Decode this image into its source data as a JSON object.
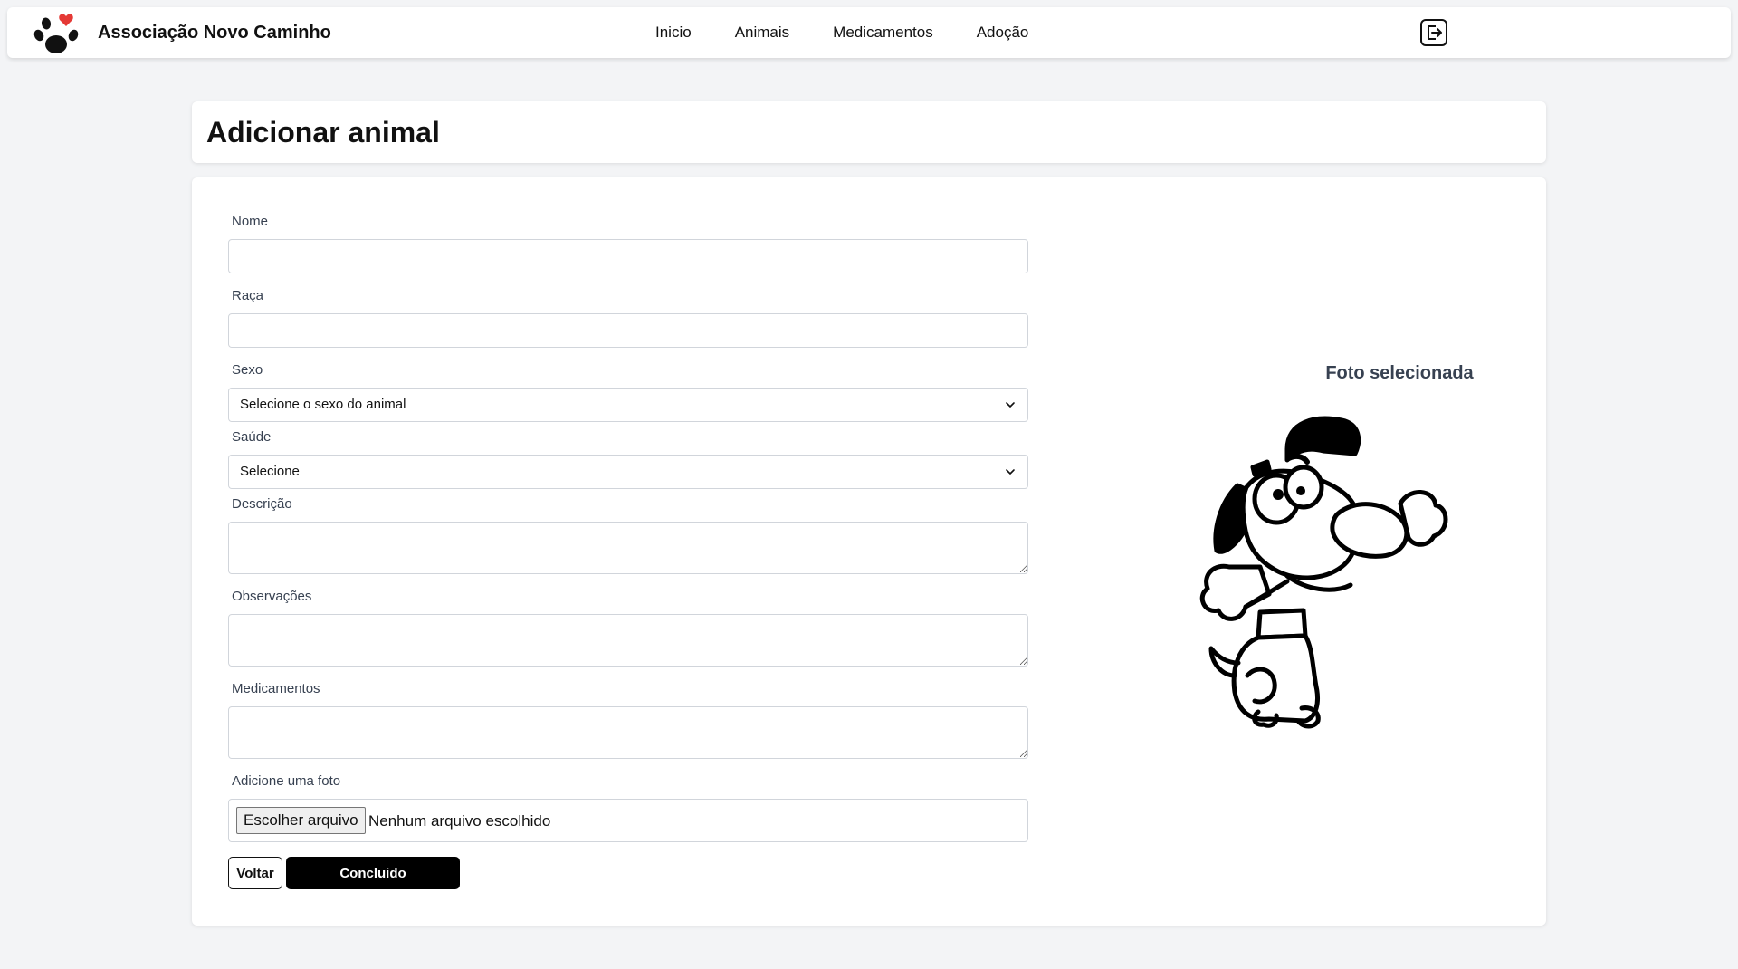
{
  "header": {
    "brand": "Associação Novo Caminho",
    "nav": [
      "Inicio",
      "Animais",
      "Medicamentos",
      "Adoção"
    ],
    "logo_icon": "paw-heart-icon",
    "logout_icon": "logout-icon",
    "accent_color": "#e53935"
  },
  "page": {
    "title": "Adicionar animal"
  },
  "form": {
    "name_label": "Nome",
    "name_value": "",
    "breed_label": "Raça",
    "breed_value": "",
    "sex_label": "Sexo",
    "sex_selected": "Selecione o sexo do animal",
    "health_label": "Saúde",
    "health_selected": "Selecione",
    "description_label": "Descrição",
    "description_value": "",
    "notes_label": "Observações",
    "notes_value": "",
    "medications_label": "Medicamentos",
    "medications_value": "",
    "photo_label": "Adicione uma foto",
    "file_button": "Escolher arquivo",
    "file_status": "Nenhum arquivo escolhido",
    "back_button": "Voltar",
    "done_button": "Concluido"
  },
  "preview": {
    "title": "Foto selecionada",
    "image_icon": "cartoon-dog-with-bone"
  }
}
